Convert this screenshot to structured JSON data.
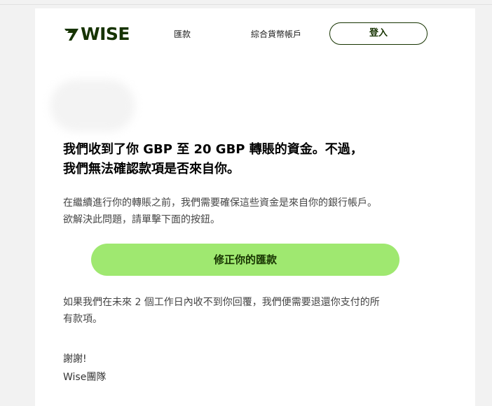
{
  "brand": {
    "name": "WISE",
    "color": "#163300",
    "accent": "#9fe870"
  },
  "nav": {
    "remit_label": "匯款",
    "account_label": "綜合貨幣帳戶",
    "login_label": "登入"
  },
  "message": {
    "headline_line1": "我們收到了你 GBP 至 20 GBP 轉賬的資金。不過，",
    "headline_line2": "我們無法確認款項是否來自你。",
    "para1_line1": "在繼續進行你的轉賬之前，我們需要確保這些資金是來自你的銀行帳戶。",
    "para1_line2": "欲解決此問題，請單擊下面的按鈕。",
    "cta_label": "修正你的匯款",
    "para2_line1": "如果我們在未來 2 個工作日內收不到你回覆，我們便需要退還你支付的所",
    "para2_line2": "有款項。",
    "thanks": "謝謝!",
    "team": "Wise團隊"
  }
}
